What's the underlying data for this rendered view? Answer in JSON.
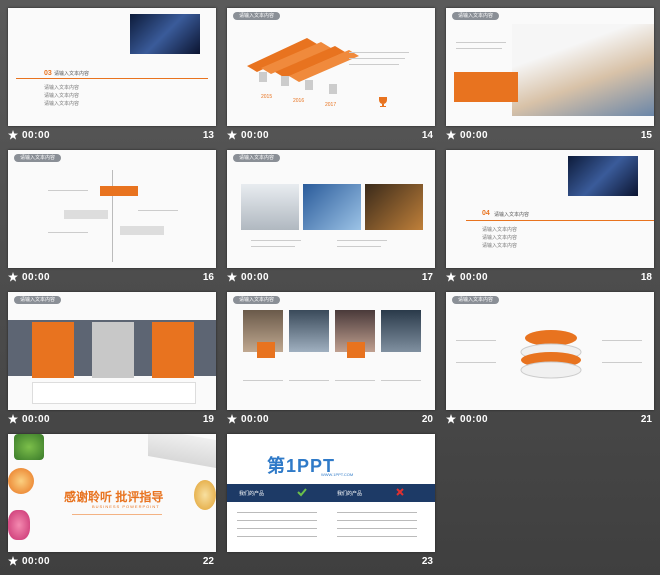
{
  "slides": [
    {
      "number": "13",
      "duration": "00:00",
      "section_num": "03",
      "section_title": "请输入文本内容",
      "items": [
        "请输入文本内容",
        "请输入文本内容",
        "请输入文本内容"
      ]
    },
    {
      "number": "14",
      "duration": "00:00",
      "tag": "请输入文本内容",
      "years": [
        "2015",
        "2016",
        "2017"
      ]
    },
    {
      "number": "15",
      "duration": "00:00",
      "tag": "请输入文本内容"
    },
    {
      "number": "16",
      "duration": "00:00",
      "tag": "请输入文本内容"
    },
    {
      "number": "17",
      "duration": "00:00",
      "tag": "请输入文本内容"
    },
    {
      "number": "18",
      "duration": "00:00",
      "section_num": "04",
      "section_title": "请输入文本内容",
      "items": [
        "请输入文本内容",
        "请输入文本内容",
        "请输入文本内容"
      ]
    },
    {
      "number": "19",
      "duration": "00:00",
      "tag": "请输入文本内容"
    },
    {
      "number": "20",
      "duration": "00:00",
      "tag": "请输入文本内容"
    },
    {
      "number": "21",
      "duration": "00:00",
      "tag": "请输入文本内容"
    },
    {
      "number": "22",
      "duration": "00:00",
      "title": "感谢聆听  批评指导",
      "subtitle": "BUSINESS POWERPOINT"
    },
    {
      "number": "23",
      "duration": "00:00",
      "logo": "第1PPT",
      "url": "WWW.1PPT.COM",
      "left_head": "我们的产品",
      "right_head": "我们的产品"
    }
  ],
  "colors": {
    "accent": "#e8731f",
    "tag": "#8a8f96",
    "navy": "#1d3a66",
    "background": "#4a4a4a"
  },
  "icons": {
    "star": "star-icon"
  }
}
